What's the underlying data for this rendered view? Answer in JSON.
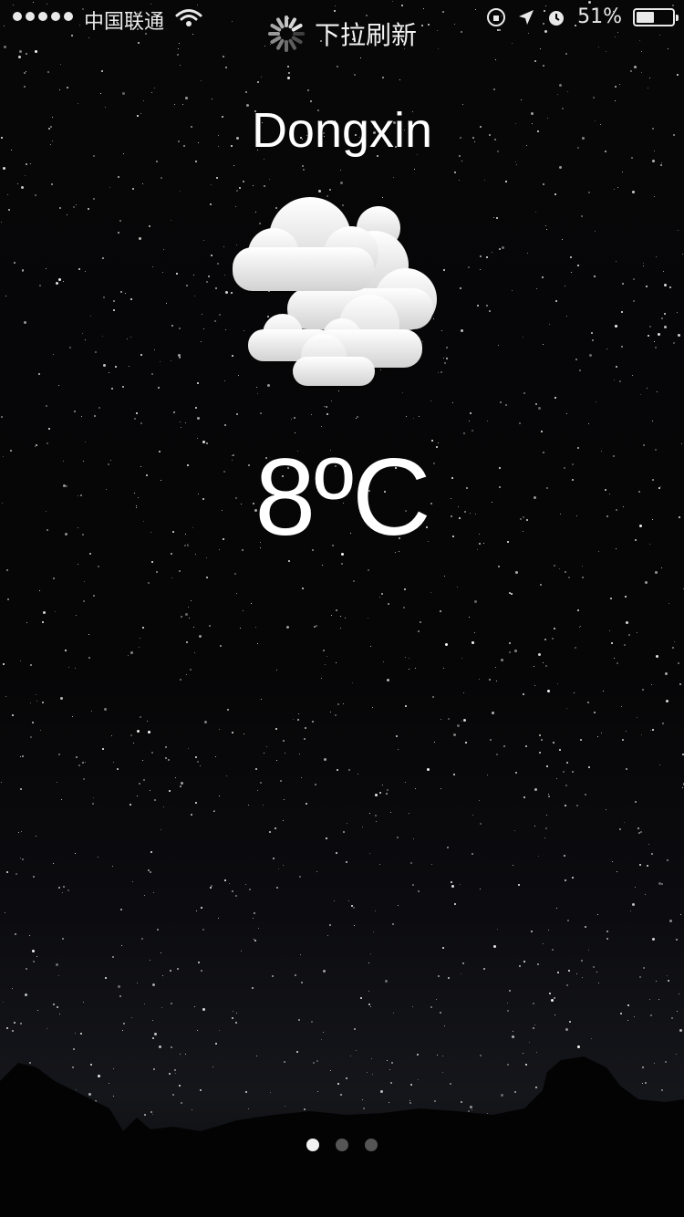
{
  "status_bar": {
    "carrier": "中国联通",
    "battery_text": "51%",
    "battery_level": 0.51,
    "signal_bars": 5
  },
  "refresh": {
    "label": "下拉刷新",
    "icon": "spinner-icon"
  },
  "weather": {
    "city": "Dongxin",
    "temperature": "8ºC",
    "condition_icon": "partly-cloudy-night-icon"
  },
  "pager": {
    "count": 3,
    "active_index": 0
  },
  "colors": {
    "text": "#ffffff",
    "background": "#060607",
    "dot_inactive": "#555555",
    "dot_active": "#f2f2f2"
  }
}
